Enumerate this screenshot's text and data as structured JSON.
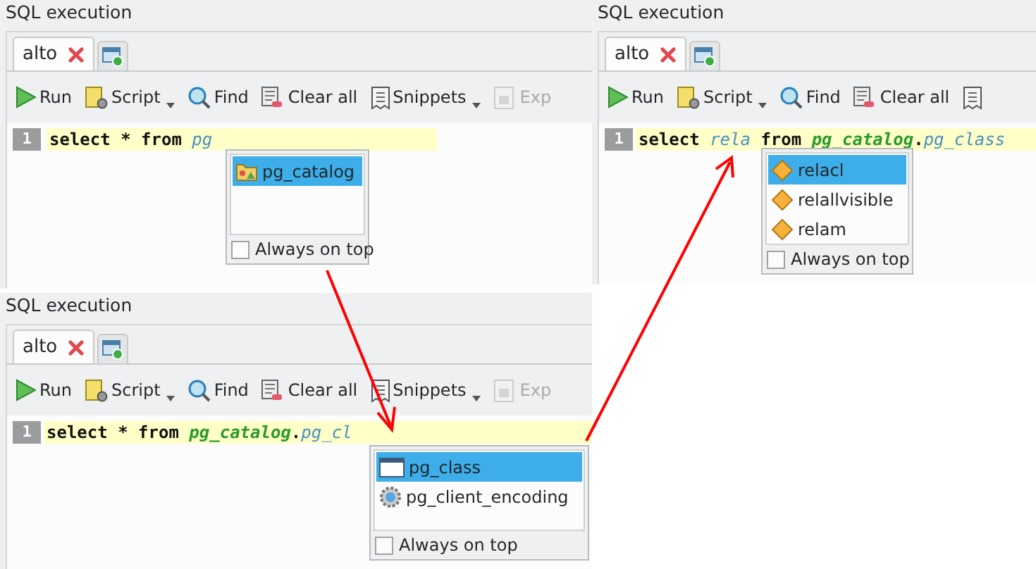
{
  "panels": [
    {
      "title": "SQL execution",
      "tabs": [
        {
          "label": "alto",
          "selected": true
        }
      ],
      "toolbar": [
        {
          "label": "Run",
          "kind": "run",
          "dropdown": false,
          "disabled": false
        },
        {
          "label": "Script",
          "kind": "script",
          "dropdown": true,
          "disabled": false
        },
        {
          "label": "Find",
          "kind": "find",
          "dropdown": false,
          "disabled": false
        },
        {
          "label": "Clear all",
          "kind": "clear",
          "dropdown": false,
          "disabled": false
        },
        {
          "label": "Snippets",
          "kind": "snippets",
          "dropdown": true,
          "disabled": false
        },
        {
          "label": "Exp",
          "kind": "export",
          "dropdown": false,
          "disabled": true
        }
      ],
      "line_number": "1",
      "code": [
        {
          "text": "select",
          "kind": "keyword"
        },
        {
          "text": " * ",
          "kind": "plain"
        },
        {
          "text": "from ",
          "kind": "keyword"
        },
        {
          "text": "pg",
          "kind": "ident"
        }
      ],
      "completion": {
        "items": [
          {
            "label": "pg_catalog",
            "kind": "schema",
            "selected": true
          }
        ],
        "always_on_top": {
          "label": "Always on top",
          "checked": false
        }
      }
    },
    {
      "title": "SQL execution",
      "tabs": [
        {
          "label": "alto",
          "selected": true
        }
      ],
      "toolbar": [
        {
          "label": "Run",
          "kind": "run",
          "dropdown": false,
          "disabled": false
        },
        {
          "label": "Script",
          "kind": "script",
          "dropdown": true,
          "disabled": false
        },
        {
          "label": "Find",
          "kind": "find",
          "dropdown": false,
          "disabled": false
        },
        {
          "label": "Clear all",
          "kind": "clear",
          "dropdown": false,
          "disabled": false
        },
        {
          "kind": "snippets",
          "dropdown": false,
          "disabled": false
        }
      ],
      "line_number": "1",
      "code": [
        {
          "text": "select ",
          "kind": "keyword"
        },
        {
          "text": "rela ",
          "kind": "ident"
        },
        {
          "text": "from ",
          "kind": "keyword"
        },
        {
          "text": "pg_catalog",
          "kind": "schema"
        },
        {
          "text": ".",
          "kind": "plain"
        },
        {
          "text": "pg_class",
          "kind": "ident"
        }
      ],
      "completion": {
        "items": [
          {
            "label": "relacl",
            "kind": "column",
            "selected": true
          },
          {
            "label": "relallvisible",
            "kind": "column",
            "selected": false
          },
          {
            "label": "relam",
            "kind": "column",
            "selected": false
          }
        ],
        "always_on_top": {
          "label": "Always on top",
          "checked": false
        }
      }
    },
    {
      "title": "SQL execution",
      "tabs": [
        {
          "label": "alto",
          "selected": true
        }
      ],
      "toolbar": [
        {
          "label": "Run",
          "kind": "run",
          "dropdown": false,
          "disabled": false
        },
        {
          "label": "Script",
          "kind": "script",
          "dropdown": true,
          "disabled": false
        },
        {
          "label": "Find",
          "kind": "find",
          "dropdown": false,
          "disabled": false
        },
        {
          "label": "Clear all",
          "kind": "clear",
          "dropdown": false,
          "disabled": false
        },
        {
          "label": "Snippets",
          "kind": "snippets",
          "dropdown": true,
          "disabled": false
        },
        {
          "label": "Exp",
          "kind": "export",
          "dropdown": false,
          "disabled": true
        }
      ],
      "line_number": "1",
      "code": [
        {
          "text": "select",
          "kind": "keyword"
        },
        {
          "text": " * ",
          "kind": "plain"
        },
        {
          "text": "from ",
          "kind": "keyword"
        },
        {
          "text": "pg_catalog",
          "kind": "schema"
        },
        {
          "text": ".",
          "kind": "plain"
        },
        {
          "text": "pg_cl",
          "kind": "ident"
        }
      ],
      "completion": {
        "items": [
          {
            "label": "pg_class",
            "kind": "table",
            "selected": true
          },
          {
            "label": "pg_client_encoding",
            "kind": "function",
            "selected": false
          }
        ],
        "always_on_top": {
          "label": "Always on top",
          "checked": false
        }
      }
    }
  ]
}
